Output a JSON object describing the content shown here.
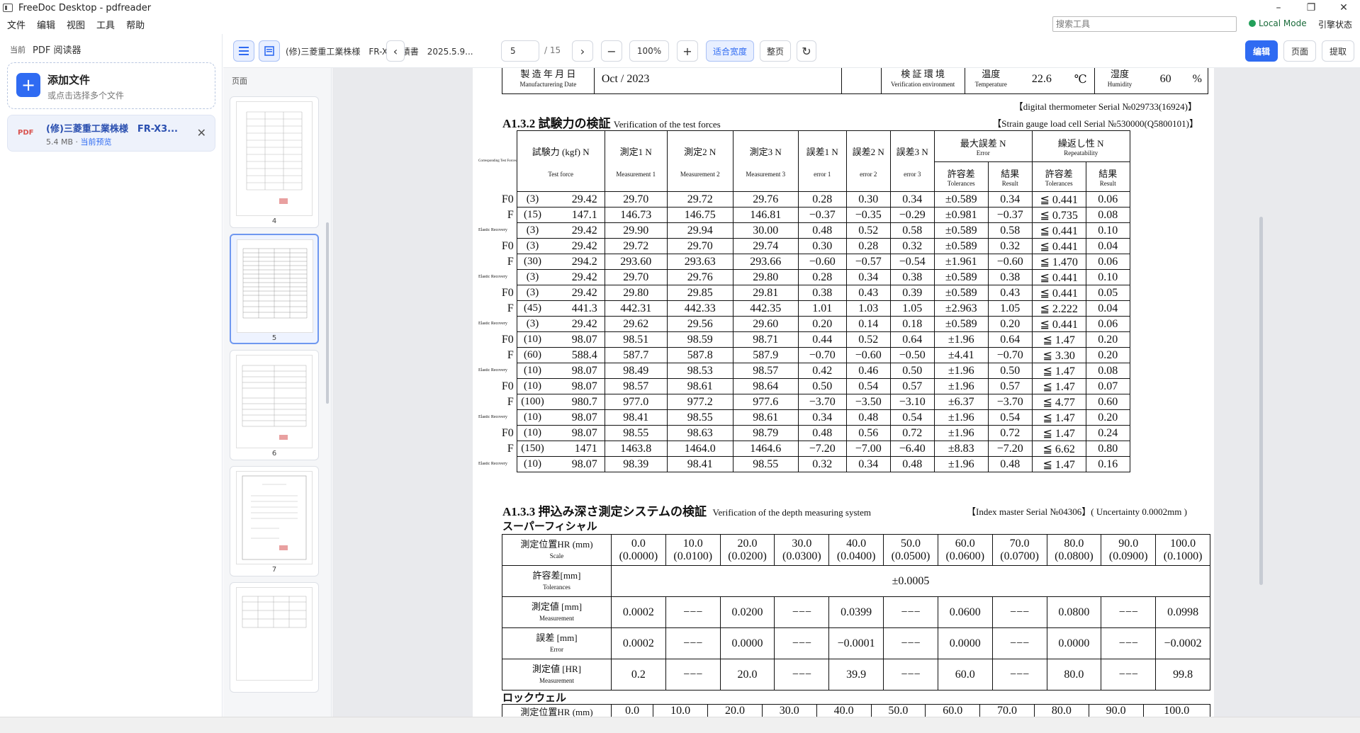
{
  "window": {
    "title": "FreeDoc Desktop - pdfreader",
    "minimize": "–",
    "maximize": "❐",
    "close": "✕"
  },
  "menu": {
    "items": [
      "文件",
      "编辑",
      "视图",
      "工具",
      "帮助"
    ],
    "search_placeholder": "搜索工具",
    "mode": "Local Mode",
    "engine_status": "引擎状态"
  },
  "sidebar": {
    "tag": "当前",
    "app_name": "PDF 阅读器",
    "add_file_title": "添加文件",
    "add_file_hint": "或点击选择多个文件",
    "file": {
      "badge": "PDF",
      "name": "(修)三菱重工業株様　FR-X3...",
      "size": "5.4 MB · ",
      "status": "当前预览"
    }
  },
  "toolbar": {
    "doc_title": "(修)三菱重工業株様　FR-X3成績書　2025.5.9...",
    "prev": "‹",
    "next": "›",
    "page": "5",
    "page_total": "/ 15",
    "zoom_out": "−",
    "zoom": "100%",
    "zoom_in": "+",
    "fit_width": "适合宽度",
    "full_page": "整页",
    "rotate": "↻",
    "edit": "编辑",
    "page_mode": "页面",
    "extract": "提取"
  },
  "thumbnails": {
    "label": "页面",
    "pages": [
      "4",
      "5",
      "6",
      "7"
    ],
    "selected": "5"
  },
  "doc": {
    "env": {
      "mfg_date_label": "製 造 年 月 日",
      "mfg_date_en": "Manufacturering Date",
      "mfg_date": "Oct / 2023",
      "verif_label": "検 証 環 境",
      "verif_en": "Verification environment",
      "temp_label": "温度",
      "temp_en": "Temperature",
      "temp": "22.6",
      "temp_unit": "℃",
      "hum_label": "湿度",
      "hum_en": "Humidity",
      "hum": "60",
      "hum_unit": "%"
    },
    "thermo_note": "【digital thermometer Serial №029733(16924)】",
    "s132": {
      "title": "A1.3.2 試験力の検証",
      "title_en": "Verification of the test forces",
      "note": "【Strain gauge load cell Serial №530000(Q5800101)】",
      "corner": "Corresponding Test Forces",
      "headers": [
        "試験力 (kgf) N",
        "測定1 N",
        "測定2 N",
        "測定3 N",
        "誤差1 N",
        "誤差2 N",
        "誤差3 N",
        "最大誤差 N",
        "繰返し性 N"
      ],
      "headers_en": [
        "Test force",
        "Measurement 1",
        "Measurement 2",
        "Measurement 3",
        "error 1",
        "error 2",
        "error 3",
        "Error",
        "Repeatability"
      ],
      "sub": [
        "許容差",
        "結果",
        "許容差",
        "結果"
      ],
      "sub_en": [
        "Tolerances",
        "Result",
        "Tolerances",
        "Result"
      ],
      "rows": [
        [
          "F0",
          "(3)",
          "29.42",
          "29.70",
          "29.72",
          "29.76",
          "0.28",
          "0.30",
          "0.34",
          "±0.589",
          "0.34",
          "≦ 0.441",
          "0.06"
        ],
        [
          "F",
          "(15)",
          "147.1",
          "146.73",
          "146.75",
          "146.81",
          "−0.37",
          "−0.35",
          "−0.29",
          "±0.981",
          "−0.37",
          "≦ 0.735",
          "0.08"
        ],
        [
          "Elastic Recovery",
          "(3)",
          "29.42",
          "29.90",
          "29.94",
          "30.00",
          "0.48",
          "0.52",
          "0.58",
          "±0.589",
          "0.58",
          "≦ 0.441",
          "0.10"
        ],
        [
          "F0",
          "(3)",
          "29.42",
          "29.72",
          "29.70",
          "29.74",
          "0.30",
          "0.28",
          "0.32",
          "±0.589",
          "0.32",
          "≦ 0.441",
          "0.04"
        ],
        [
          "F",
          "(30)",
          "294.2",
          "293.60",
          "293.63",
          "293.66",
          "−0.60",
          "−0.57",
          "−0.54",
          "±1.961",
          "−0.60",
          "≦ 1.470",
          "0.06"
        ],
        [
          "Elastic Recovery",
          "(3)",
          "29.42",
          "29.70",
          "29.76",
          "29.80",
          "0.28",
          "0.34",
          "0.38",
          "±0.589",
          "0.38",
          "≦ 0.441",
          "0.10"
        ],
        [
          "F0",
          "(3)",
          "29.42",
          "29.80",
          "29.85",
          "29.81",
          "0.38",
          "0.43",
          "0.39",
          "±0.589",
          "0.43",
          "≦ 0.441",
          "0.05"
        ],
        [
          "F",
          "(45)",
          "441.3",
          "442.31",
          "442.33",
          "442.35",
          "1.01",
          "1.03",
          "1.05",
          "±2.963",
          "1.05",
          "≦ 2.222",
          "0.04"
        ],
        [
          "Elastic Recovery",
          "(3)",
          "29.42",
          "29.62",
          "29.56",
          "29.60",
          "0.20",
          "0.14",
          "0.18",
          "±0.589",
          "0.20",
          "≦ 0.441",
          "0.06"
        ],
        [
          "F0",
          "(10)",
          "98.07",
          "98.51",
          "98.59",
          "98.71",
          "0.44",
          "0.52",
          "0.64",
          "±1.96",
          "0.64",
          "≦ 1.47",
          "0.20"
        ],
        [
          "F",
          "(60)",
          "588.4",
          "587.7",
          "587.8",
          "587.9",
          "−0.70",
          "−0.60",
          "−0.50",
          "±4.41",
          "−0.70",
          "≦ 3.30",
          "0.20"
        ],
        [
          "Elastic Recovery",
          "(10)",
          "98.07",
          "98.49",
          "98.53",
          "98.57",
          "0.42",
          "0.46",
          "0.50",
          "±1.96",
          "0.50",
          "≦ 1.47",
          "0.08"
        ],
        [
          "F0",
          "(10)",
          "98.07",
          "98.57",
          "98.61",
          "98.64",
          "0.50",
          "0.54",
          "0.57",
          "±1.96",
          "0.57",
          "≦ 1.47",
          "0.07"
        ],
        [
          "F",
          "(100)",
          "980.7",
          "977.0",
          "977.2",
          "977.6",
          "−3.70",
          "−3.50",
          "−3.10",
          "±6.37",
          "−3.70",
          "≦ 4.77",
          "0.60"
        ],
        [
          "Elastic Recovery",
          "(10)",
          "98.07",
          "98.41",
          "98.55",
          "98.61",
          "0.34",
          "0.48",
          "0.54",
          "±1.96",
          "0.54",
          "≦ 1.47",
          "0.20"
        ],
        [
          "F0",
          "(10)",
          "98.07",
          "98.55",
          "98.63",
          "98.79",
          "0.48",
          "0.56",
          "0.72",
          "±1.96",
          "0.72",
          "≦ 1.47",
          "0.24"
        ],
        [
          "F",
          "(150)",
          "1471",
          "1463.8",
          "1464.0",
          "1464.6",
          "−7.20",
          "−7.00",
          "−6.40",
          "±8.83",
          "−7.20",
          "≦ 6.62",
          "0.80"
        ],
        [
          "Elastic Recovery",
          "(10)",
          "98.07",
          "98.39",
          "98.41",
          "98.55",
          "0.32",
          "0.34",
          "0.48",
          "±1.96",
          "0.48",
          "≦ 1.47",
          "0.16"
        ]
      ]
    },
    "s133": {
      "title": "A1.3.3 押込み深さ測定システムの検証",
      "title_en": "Verification of the depth measuring system",
      "note": "【Index master Serial №04306】( Uncertainty 0.0002mm )",
      "sub1": "スーパーフィシャル",
      "sub2": "ロックウェル",
      "pos_label": "測定位置HR (mm)",
      "pos_label_en": "Scale",
      "positions": [
        [
          "0.0",
          "(0.0000)"
        ],
        [
          "10.0",
          "(0.0100)"
        ],
        [
          "20.0",
          "(0.0200)"
        ],
        [
          "30.0",
          "(0.0300)"
        ],
        [
          "40.0",
          "(0.0400)"
        ],
        [
          "50.0",
          "(0.0500)"
        ],
        [
          "60.0",
          "(0.0600)"
        ],
        [
          "70.0",
          "(0.0700)"
        ],
        [
          "80.0",
          "(0.0800)"
        ],
        [
          "90.0",
          "(0.0900)"
        ],
        [
          "100.0",
          "(0.1000)"
        ]
      ],
      "tol_label": "許容差[mm]",
      "tol_label_en": "Tolerances",
      "tol_value": "±0.0005",
      "meas_label": "測定値 [mm]",
      "meas_label_en": "Measurement",
      "meas": [
        "0.0002",
        "−−−",
        "0.0200",
        "−−−",
        "0.0399",
        "−−−",
        "0.0600",
        "−−−",
        "0.0800",
        "−−−",
        "0.0998"
      ],
      "err_label": "誤差 [mm]",
      "err_label_en": "Error",
      "err": [
        "0.0002",
        "−−−",
        "0.0000",
        "−−−",
        "−0.0001",
        "−−−",
        "0.0000",
        "−−−",
        "0.0000",
        "−−−",
        "−0.0002"
      ],
      "hr_label": "測定値 [HR]",
      "hr_label_en": "Measurement",
      "hr": [
        "0.2",
        "−−−",
        "20.0",
        "−−−",
        "39.9",
        "−−−",
        "60.0",
        "−−−",
        "80.0",
        "−−−",
        "99.8"
      ],
      "rock_pos": [
        "0.0",
        "10.0",
        "20.0",
        "30.0",
        "40.0",
        "50.0",
        "60.0",
        "70.0",
        "80.0",
        "90.0",
        "100.0"
      ]
    }
  }
}
